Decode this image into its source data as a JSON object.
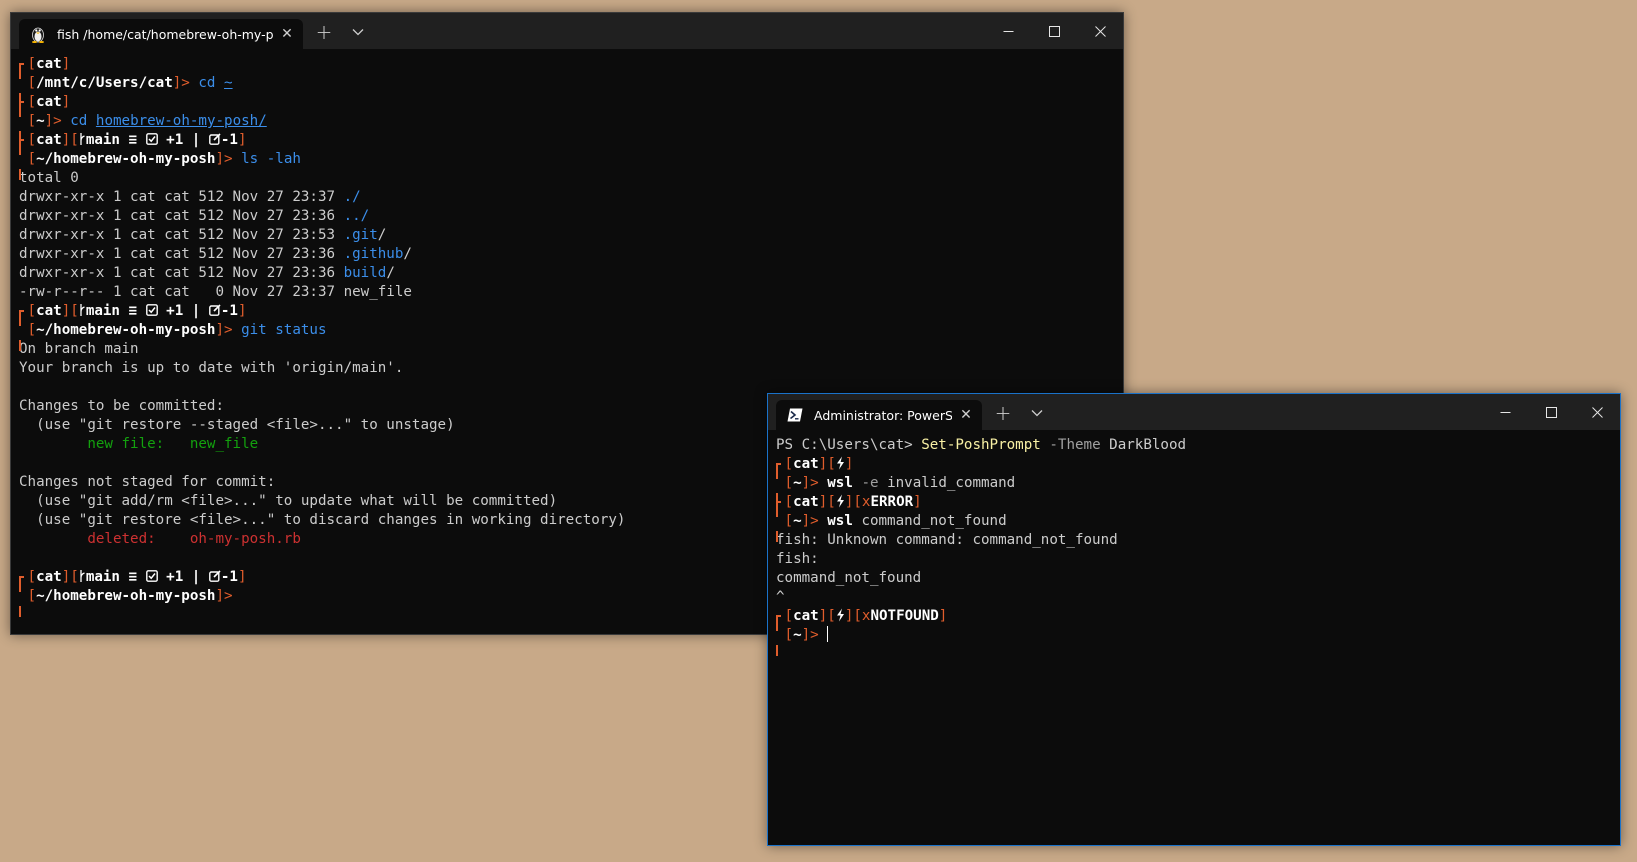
{
  "win1": {
    "tab_title": "fish /home/cat/homebrew-oh-my-posh",
    "lines": [
      {
        "kind": "p1",
        "user": "cat"
      },
      {
        "kind": "p2",
        "dir": "/mnt/c/Users/cat",
        "cmd": "cd",
        "arg": "~"
      },
      {
        "kind": "p1",
        "user": "cat"
      },
      {
        "kind": "p2",
        "dir": "~",
        "cmd": "cd",
        "arg": "homebrew-oh-my-posh/"
      },
      {
        "kind": "p1g",
        "user": "cat",
        "branch": "main ≡",
        "staged": "+1",
        "sep": "|",
        "unstaged": "-1"
      },
      {
        "kind": "p2",
        "dir": "~/homebrew-oh-my-posh",
        "cmd": "ls",
        "arg": "-lah"
      },
      {
        "kind": "t",
        "text": "total 0"
      },
      {
        "kind": "ls",
        "meta": "drwxr-xr-x 1 cat cat 512 Nov 27 23:37 ",
        "name": "./",
        "suffix": ""
      },
      {
        "kind": "ls",
        "meta": "drwxr-xr-x 1 cat cat 512 Nov 27 23:36 ",
        "name": "../",
        "suffix": ""
      },
      {
        "kind": "ls",
        "meta": "drwxr-xr-x 1 cat cat 512 Nov 27 23:53 ",
        "name": ".git",
        "suffix": "/"
      },
      {
        "kind": "ls",
        "meta": "drwxr-xr-x 1 cat cat 512 Nov 27 23:36 ",
        "name": ".github",
        "suffix": "/"
      },
      {
        "kind": "ls",
        "meta": "drwxr-xr-x 1 cat cat 512 Nov 27 23:36 ",
        "name": "build",
        "suffix": "/"
      },
      {
        "kind": "t",
        "text": "-rw-r--r-- 1 cat cat   0 Nov 27 23:37 new_file"
      },
      {
        "kind": "p1g",
        "user": "cat",
        "branch": "main ≡",
        "staged": "+1",
        "sep": "|",
        "unstaged": "-1"
      },
      {
        "kind": "p2",
        "dir": "~/homebrew-oh-my-posh",
        "cmd": "git",
        "arg": "status"
      },
      {
        "kind": "t",
        "text": "On branch main"
      },
      {
        "kind": "t",
        "text": "Your branch is up to date with 'origin/main'."
      },
      {
        "kind": "t",
        "text": ""
      },
      {
        "kind": "t",
        "text": "Changes to be committed:"
      },
      {
        "kind": "t",
        "text": "  (use \"git restore --staged <file>...\" to unstage)"
      },
      {
        "kind": "c",
        "color": "g2",
        "text": "        new file:   new_file"
      },
      {
        "kind": "t",
        "text": ""
      },
      {
        "kind": "t",
        "text": "Changes not staged for commit:"
      },
      {
        "kind": "t",
        "text": "  (use \"git add/rm <file>...\" to update what will be committed)"
      },
      {
        "kind": "t",
        "text": "  (use \"git restore <file>...\" to discard changes in working directory)"
      },
      {
        "kind": "c",
        "color": "r",
        "text": "        deleted:    oh-my-posh.rb"
      },
      {
        "kind": "t",
        "text": ""
      },
      {
        "kind": "p1g",
        "user": "cat",
        "branch": "main ≡",
        "staged": "+1",
        "sep": "|",
        "unstaged": "-1"
      },
      {
        "kind": "p2",
        "dir": "~/homebrew-oh-my-posh",
        "cmd": "",
        "arg": ""
      }
    ]
  },
  "win2": {
    "tab_title": "Administrator: PowerShell",
    "lines": [
      {
        "kind": "ps",
        "prompt": "PS C:\\Users\\cat> ",
        "cmd": "Set-PoshPrompt",
        "flag": "-Theme",
        "arg": "DarkBlood"
      },
      {
        "kind": "p1x",
        "user": "cat",
        "bolt": "ϟ",
        "err": ""
      },
      {
        "kind": "p2w",
        "dir": "~",
        "cmd": "wsl",
        "flag": "-e",
        "arg": "invalid_command"
      },
      {
        "kind": "p1x",
        "user": "cat",
        "bolt": "ϟ",
        "err": "ERROR"
      },
      {
        "kind": "p2w",
        "dir": "~",
        "cmd": "wsl",
        "flag": "",
        "arg": "command_not_found"
      },
      {
        "kind": "t",
        "text": "fish: Unknown command: command_not_found"
      },
      {
        "kind": "t",
        "text": "fish:"
      },
      {
        "kind": "t",
        "text": "command_not_found"
      },
      {
        "kind": "t",
        "text": "^"
      },
      {
        "kind": "p1x",
        "user": "cat",
        "bolt": "ϟ",
        "err": "NOTFOUND"
      },
      {
        "kind": "p2c",
        "dir": "~"
      }
    ]
  }
}
